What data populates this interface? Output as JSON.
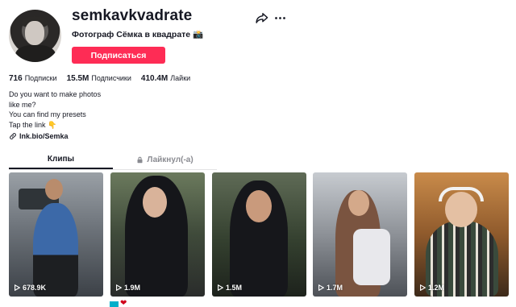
{
  "profile": {
    "username": "semkavkvadrate",
    "subtitle": "Фотограф Сёмка в квадрате 📸",
    "follow_label": "Подписаться"
  },
  "stats": [
    {
      "value": "716",
      "label": "Подписки"
    },
    {
      "value": "15.5M",
      "label": "Подписчики"
    },
    {
      "value": "410.4M",
      "label": "Лайки"
    }
  ],
  "bio": {
    "line1": "Do you want to make photos",
    "line2": "like me?",
    "line3": "You can find my presets",
    "line4": "Tap the link 👇"
  },
  "link": {
    "text": "lnk.bio/Semka"
  },
  "tabs": [
    {
      "label": "Клипы",
      "active": true
    },
    {
      "label": "Лайкнул(-а)",
      "active": false,
      "icon": "lock-icon"
    }
  ],
  "videos": [
    {
      "views": "678.9K"
    },
    {
      "views": "1.9M"
    },
    {
      "views": "1.5M"
    },
    {
      "views": "1.7M"
    },
    {
      "views": "1.2M"
    }
  ],
  "colors": {
    "accent": "#fe2c55",
    "text": "#161823",
    "muted": "#8a8b91"
  }
}
